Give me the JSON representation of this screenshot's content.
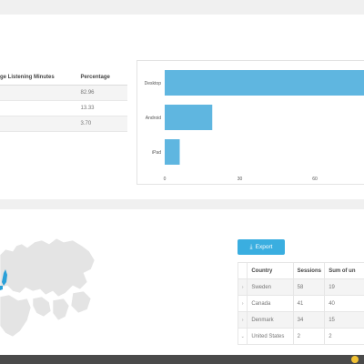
{
  "device_table": {
    "headers": [
      "ge Listening Minutes",
      "Percentage"
    ],
    "rows": [
      {
        "name": "",
        "percentage": "82.96"
      },
      {
        "name": "",
        "percentage": "13.33"
      },
      {
        "name": "",
        "percentage": "3.70"
      }
    ]
  },
  "chart_data": {
    "type": "bar",
    "orientation": "horizontal",
    "categories": [
      "Desktop",
      "Android",
      "iPad"
    ],
    "values": [
      100,
      19,
      6
    ],
    "x_ticks": [
      "0",
      "30",
      "60"
    ],
    "xlim": [
      0,
      66
    ],
    "color": "#5fb6e0"
  },
  "export_button": {
    "label": "Export",
    "icon": "download-icon"
  },
  "country_table": {
    "headers": [
      "Country",
      "Sessions",
      "Sum of un"
    ],
    "rows": [
      {
        "expander": "›",
        "country": "Sweden",
        "sessions": "58",
        "sum": "19"
      },
      {
        "expander": "›",
        "country": "Canada",
        "sessions": "41",
        "sum": "40"
      },
      {
        "expander": "›",
        "country": "Denmark",
        "sessions": "34",
        "sum": "15"
      },
      {
        "expander": "⌄",
        "country": "United States",
        "sessions": "2",
        "sum": "2"
      }
    ]
  },
  "colors": {
    "bar": "#5fb6e0",
    "button": "#3aaee0",
    "map_land": "#e4e4e4",
    "map_highlight": "#2aa0d8",
    "statusbar": "#4a4a4a"
  }
}
